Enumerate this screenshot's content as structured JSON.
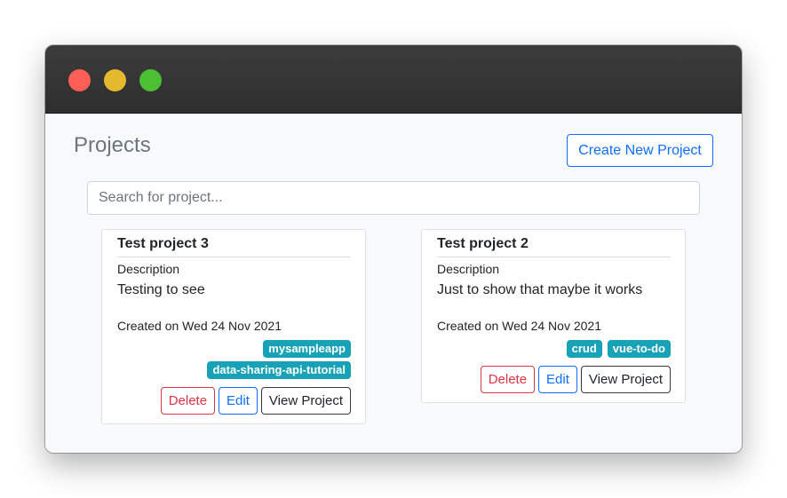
{
  "window": {
    "controls": [
      {
        "name": "close",
        "color": "#ff5f56"
      },
      {
        "name": "minimize",
        "color": "#e5b92d"
      },
      {
        "name": "maximize",
        "color": "#4cc033"
      }
    ]
  },
  "header": {
    "title": "Projects",
    "create_label": "Create New Project"
  },
  "search": {
    "placeholder": "Search for project...",
    "value": ""
  },
  "projects": [
    {
      "title": "Test project 3",
      "description_label": "Description",
      "description": "Testing to see",
      "created": "Created on Wed 24 Nov 2021",
      "tags": [
        "mysampleapp",
        "data-sharing-api-tutorial"
      ],
      "delete_label": "Delete",
      "edit_label": "Edit",
      "view_label": "View Project"
    },
    {
      "title": "Test project 2",
      "description_label": "Description",
      "description": "Just to show that maybe it works",
      "created": "Created on Wed 24 Nov 2021",
      "tags": [
        "crud",
        "vue-to-do"
      ],
      "delete_label": "Delete",
      "edit_label": "Edit",
      "view_label": "View Project"
    }
  ],
  "colors": {
    "primary": "#0d6efd",
    "danger": "#dc3545",
    "tag": "#17a2b8",
    "muted": "#6c757d"
  }
}
